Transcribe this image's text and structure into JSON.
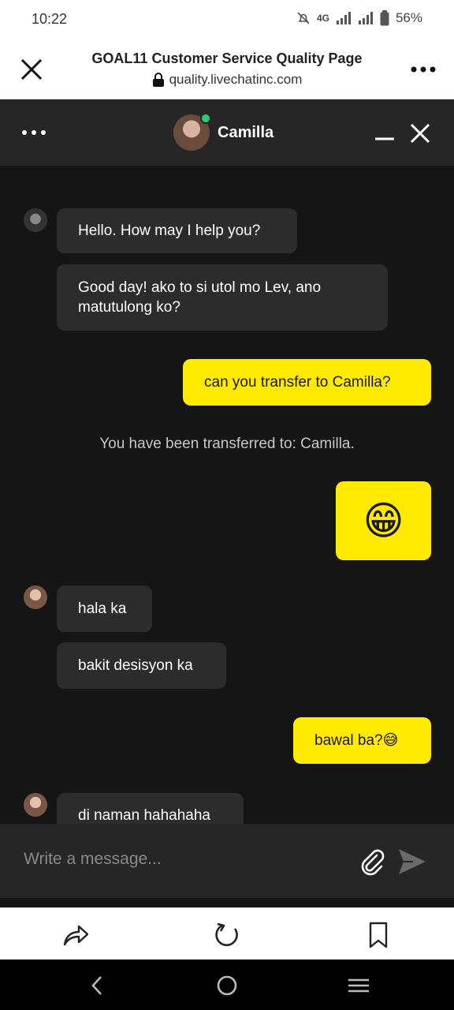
{
  "status": {
    "time": "10:22",
    "network": "4G",
    "battery": "56%"
  },
  "browser": {
    "title": "GOAL11 Customer Service Quality Page",
    "url": "quality.livechatinc.com",
    "icons": [
      "close-icon",
      "lock-icon",
      "more-icon"
    ]
  },
  "chat_header": {
    "agent_name": "Camilla",
    "icons": [
      "dots-icon",
      "minimize-icon",
      "close-icon"
    ]
  },
  "messages": [
    {
      "from": "agent",
      "text": "Hello. How may I help you?"
    },
    {
      "from": "agent",
      "text": "Good day! ako to si utol mo Lev, ano matutulong ko?"
    },
    {
      "from": "user",
      "text": "can you transfer to Camilla?"
    },
    {
      "from": "system",
      "text": "You have been transferred to: Camilla."
    },
    {
      "from": "user",
      "text": "😁"
    },
    {
      "from": "agent",
      "text": "hala ka"
    },
    {
      "from": "agent",
      "text": "bakit desisyon ka"
    },
    {
      "from": "user",
      "text": "bawal ba?😅"
    },
    {
      "from": "agent",
      "text": "di naman hahahaha"
    }
  ],
  "composer": {
    "placeholder": "Write a message..."
  },
  "colors": {
    "user_bubble": "#ffea00",
    "agent_bubble": "#2c2c2c",
    "background": "#151515",
    "online": "#2ecc71"
  }
}
